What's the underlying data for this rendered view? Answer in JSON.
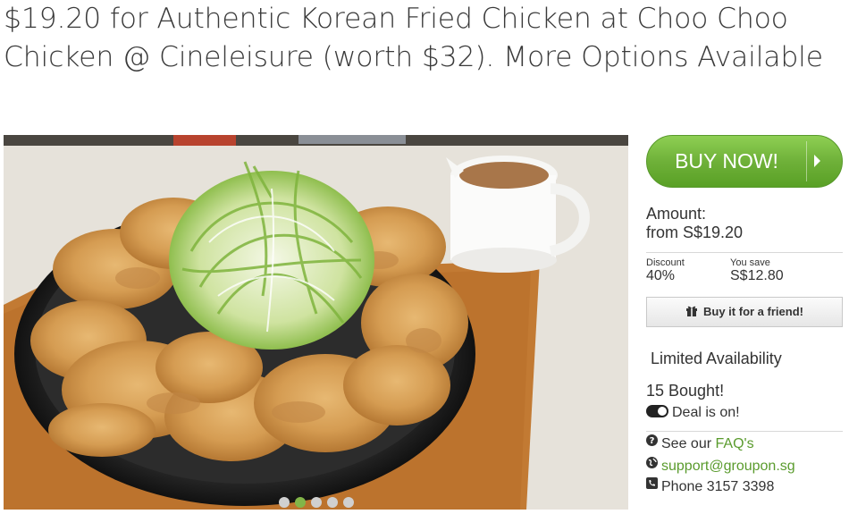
{
  "deal": {
    "title": "$19.20 for Authentic Korean Fried Chicken at Choo Choo Chicken @ Cineleisure (worth $32). More Options Available"
  },
  "gallery": {
    "slides": [
      {
        "index": 1
      },
      {
        "index": 2,
        "active": true
      },
      {
        "index": 3
      },
      {
        "index": 4
      },
      {
        "index": 5
      }
    ]
  },
  "buy": {
    "button_label": "BUY NOW!",
    "amount_label": "Amount:",
    "amount_value": "from S$19.20",
    "discount_label": "Discount",
    "discount_value": "40%",
    "save_label": "You save",
    "save_value": "S$12.80",
    "gift_label": "Buy it for a friend!"
  },
  "status": {
    "availability": "Limited Availability",
    "bought": "15 Bought!",
    "deal_state": "Deal is on!"
  },
  "support": {
    "see_our": "See our",
    "faq_link": "FAQ's",
    "email": "support@groupon.sg",
    "phone": "Phone 3157 3398"
  },
  "colors": {
    "accent_green": "#6fb139",
    "link_green": "#5a9b2d"
  },
  "icons": [
    "chevron-right-icon",
    "gift-icon",
    "toggle-on-icon",
    "question-circle-icon",
    "globe-icon",
    "phone-icon"
  ]
}
